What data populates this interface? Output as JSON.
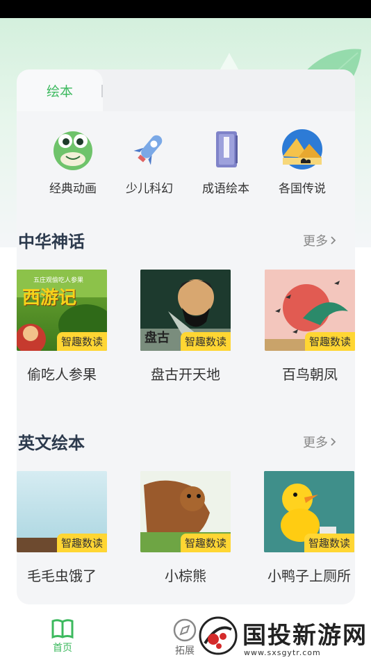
{
  "colors": {
    "accent": "#3cb95e",
    "badge": "#ffd633",
    "title": "#2c3a4d"
  },
  "tabs": [
    {
      "label": "绘本",
      "active": true
    }
  ],
  "categories": [
    {
      "label": "经典动画",
      "icon": "frog-icon"
    },
    {
      "label": "少儿科幻",
      "icon": "rocket-icon"
    },
    {
      "label": "成语绘本",
      "icon": "book-icon"
    },
    {
      "label": "各国传说",
      "icon": "pyramid-icon"
    }
  ],
  "sections": [
    {
      "title": "中华神话",
      "more": "更多",
      "books": [
        {
          "title": "偷吃人参果",
          "badge": "智趣数读",
          "cover_text": "西游记",
          "cover_subtitle": "五庄观偷吃人参果"
        },
        {
          "title": "盘古开天地",
          "badge": "智趣数读",
          "cover_text": "盘古"
        },
        {
          "title": "百鸟朝凤",
          "badge": "智趣数读"
        }
      ]
    },
    {
      "title": "英文绘本",
      "more": "更多",
      "books": [
        {
          "title": "毛毛虫饿了",
          "badge": "智趣数读"
        },
        {
          "title": "小棕熊",
          "badge": "智趣数读"
        },
        {
          "title": "小鸭子上厕所",
          "badge": "智趣数读"
        }
      ]
    }
  ],
  "nav": [
    {
      "label": "首页",
      "icon": "book-open-icon",
      "active": true
    },
    {
      "label": "拓展",
      "icon": "compass-icon",
      "active": false
    }
  ],
  "watermark": {
    "text": "国投新游网",
    "url": "www.sxsgytr.com"
  }
}
